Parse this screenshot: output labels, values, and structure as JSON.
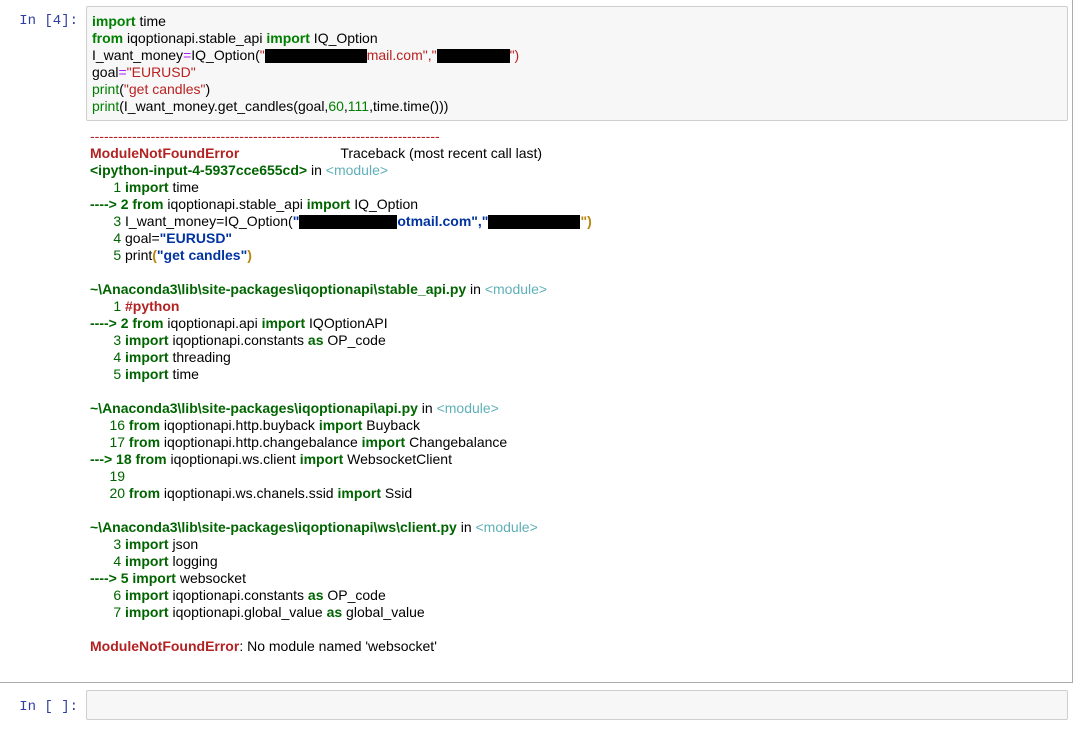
{
  "cell1": {
    "prompt": "In [4]:",
    "code": {
      "l1_kw": "import",
      "l1_rest": " time",
      "l2_kw1": "from",
      "l2_mid": " iqoptionapi.stable_api ",
      "l2_kw2": "import",
      "l2_rest": " IQ_Option",
      "l3_a": "I_want_money",
      "l3_eq": "=",
      "l3_b": "IQ_Option(",
      "l3_s1": "\"",
      "l3_s2": "mail.com\",\"",
      "l3_s3": "\")",
      "l4_a": "goal",
      "l4_eq": "=",
      "l4_s": "\"EURUSD\"",
      "l5_fn": "print",
      "l5_p": "(",
      "l5_s": "\"get candles\"",
      "l5_e": ")",
      "l6_fn": "print",
      "l6_a": "(I_want_money.get_candles(goal,",
      "l6_n1": "60",
      "l6_c1": ",",
      "l6_n2": "111",
      "l6_b": ",time.time()))"
    },
    "output": {
      "dashes": "---------------------------------------------------------------------------",
      "err_name": "ModuleNotFoundError",
      "traceback": "Traceback (most recent call last)",
      "input_file": "<ipython-input-4-5937cce655cd>",
      "in_word": " in ",
      "module_tag": "<module>",
      "tb1": {
        "l1_num": "      1 ",
        "l1_kw": "import",
        "l1_rest": " time",
        "l2_arrow": "----> 2 ",
        "l2_kw1": "from",
        "l2_mid": " iqoptionapi.stable_api ",
        "l2_kw2": "import",
        "l2_rest": " IQ_Option",
        "l3_num": "      3 ",
        "l3_a": "I_want_money=IQ_Option(",
        "l3_s1": "\"",
        "l3_s2": "otmail.com\",\"",
        "l3_s3": "\")",
        "l4_num": "      4 ",
        "l4_a": "goal=",
        "l4_s": "\"EURUSD\"",
        "l5_num": "      5 ",
        "l5_a": "print",
        "l5_p": "(",
        "l5_s": "\"get candles\"",
        "l5_e": ")"
      },
      "file2": "~\\Anaconda3\\lib\\site-packages\\iqoptionapi\\stable_api.py",
      "tb2": {
        "l1_num": "      1 ",
        "l1_c": "#python",
        "l2_arrow": "----> 2 ",
        "l2_kw1": "from",
        "l2_mid": " iqoptionapi.api ",
        "l2_kw2": "import",
        "l2_rest": " IQOptionAPI",
        "l3_num": "      3 ",
        "l3_kw": "import",
        "l3_mid": " iqoptionapi.constants ",
        "l3_as": "as",
        "l3_rest": " OP_code",
        "l4_num": "      4 ",
        "l4_kw": "import",
        "l4_rest": " threading",
        "l5_num": "      5 ",
        "l5_kw": "import",
        "l5_rest": " time"
      },
      "file3": "~\\Anaconda3\\lib\\site-packages\\iqoptionapi\\api.py",
      "tb3": {
        "l1_num": "     16 ",
        "l1_kw1": "from",
        "l1_mid": " iqoptionapi.http.buyback ",
        "l1_kw2": "import",
        "l1_rest": " Buyback",
        "l2_num": "     17 ",
        "l2_kw1": "from",
        "l2_mid": " iqoptionapi.http.changebalance ",
        "l2_kw2": "import",
        "l2_rest": " Changebalance",
        "l3_arrow": "---> 18 ",
        "l3_kw1": "from",
        "l3_mid": " iqoptionapi.ws.client ",
        "l3_kw2": "import",
        "l3_rest": " WebsocketClient",
        "l4_num": "     19",
        "l5_num": "     20 ",
        "l5_kw1": "from",
        "l5_mid": " iqoptionapi.ws.chanels.ssid ",
        "l5_kw2": "import",
        "l5_rest": " Ssid"
      },
      "file4": "~\\Anaconda3\\lib\\site-packages\\iqoptionapi\\ws\\client.py",
      "tb4": {
        "l1_num": "      3 ",
        "l1_kw": "import",
        "l1_rest": " json",
        "l2_num": "      4 ",
        "l2_kw": "import",
        "l2_rest": " logging",
        "l3_arrow": "----> 5 ",
        "l3_kw": "import",
        "l3_rest": " websocket",
        "l4_num": "      6 ",
        "l4_kw": "import",
        "l4_mid": " iqoptionapi.constants ",
        "l4_as": "as",
        "l4_rest": " OP_code",
        "l5_num": "      7 ",
        "l5_kw": "import",
        "l5_mid": " iqoptionapi.global_value ",
        "l5_as": "as",
        "l5_rest": " global_value"
      },
      "final_err": "ModuleNotFoundError",
      "final_msg": ": No module named 'websocket'"
    }
  },
  "cell2": {
    "prompt": "In [ ]:"
  }
}
